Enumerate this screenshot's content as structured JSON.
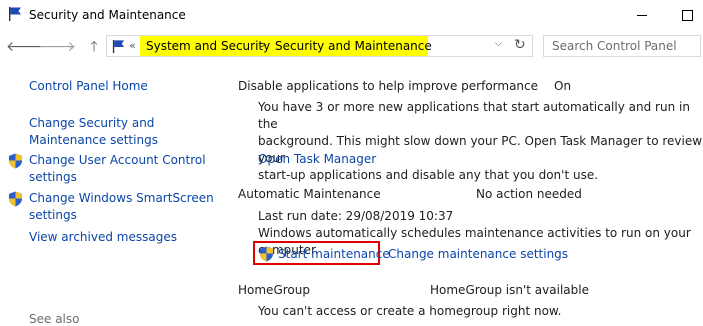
{
  "window": {
    "title": "Security and Maintenance"
  },
  "navigation": {
    "breadcrumb": {
      "chevron": "«",
      "items": [
        "System and Security",
        "Security and Maintenance"
      ],
      "separator": ">"
    },
    "search_placeholder": "Search Control Panel"
  },
  "sidebar": {
    "home": "Control Panel Home",
    "items": [
      {
        "label_line1": "Change Security and",
        "label_line2": "Maintenance settings"
      },
      {
        "label_line1": "Change User Account Control",
        "label_line2": "settings"
      },
      {
        "label_line1": "Change Windows SmartScreen",
        "label_line2": "settings"
      },
      {
        "label_line1": "View archived messages"
      }
    ],
    "see_also": "See also"
  },
  "main": {
    "startup_apps": {
      "title": "Disable applications to help improve performance",
      "status": "On",
      "description_line1": "You have 3 or more new applications that start automatically and run in the",
      "description_line2": "background. This might slow down your PC. Open Task Manager to review your",
      "description_line3": "start-up applications and disable any that you don't use.",
      "action": "Open Task Manager"
    },
    "maintenance": {
      "title": "Automatic Maintenance",
      "status": "No action needed",
      "last_run": "Last run date: 29/08/2019 10:37",
      "description": "Windows automatically schedules maintenance activities to run on your computer.",
      "start_action": "Start maintenance",
      "settings_action": "Change maintenance settings"
    },
    "homegroup": {
      "title": "HomeGroup",
      "status": "HomeGroup isn't available",
      "description": "You can't access or create a homegroup right now."
    }
  },
  "colors": {
    "link": "#0b46a8",
    "highlight": "#ffff00",
    "annotation_box": "#e00000"
  }
}
